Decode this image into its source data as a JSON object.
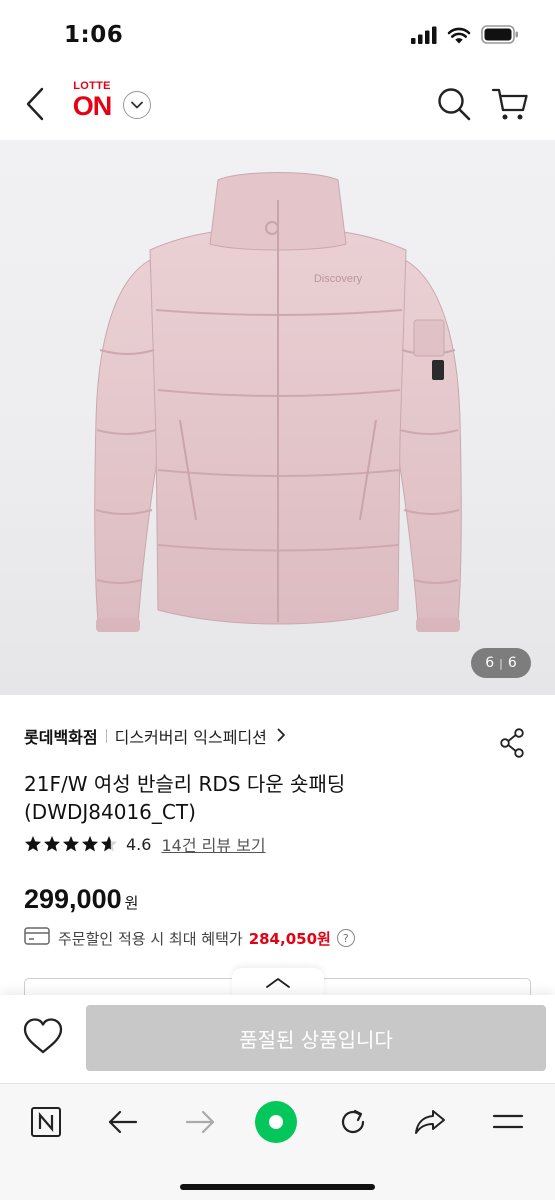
{
  "status_bar": {
    "time": "1:06",
    "icons": [
      "cellular-signal-icon",
      "wifi-icon",
      "battery-icon"
    ]
  },
  "header": {
    "back_icon": "chevron-left-icon",
    "logo_top": "LOTTE",
    "logo_main": "ON",
    "logo_dropdown_icon": "chevron-down-icon",
    "search_icon": "search-icon",
    "cart_icon": "cart-icon"
  },
  "gallery": {
    "current": "6",
    "separator": "|",
    "total": "6",
    "product_print": "Discovery"
  },
  "product": {
    "brand": "롯데백화점",
    "brand_line": "디스커버리 익스페디션",
    "title_line1": "21F/W 여성 반슬리 RDS 다운 숏패딩",
    "title_line2": "(DWDJ84016_CT)",
    "rating": "4.6",
    "review_link": "14건 리뷰 보기",
    "stars_value": 4.6,
    "stars_max": 5,
    "price": "299,000",
    "price_unit": "원",
    "benefit_text": "주문할인 적용 시 최대 혜택가",
    "benefit_price": "284,050원",
    "help_glyph": "?"
  },
  "purchase_bar": {
    "wish_icon": "heart-icon",
    "soldout_label": "품절된 상품입니다"
  },
  "browser_toolbar": {
    "items": [
      "naver-home-icon",
      "back-arrow-icon",
      "forward-arrow-icon",
      "green-dot-icon",
      "refresh-icon",
      "share-icon",
      "menu-icon"
    ]
  },
  "colors": {
    "brand_red": "#e60012",
    "soldout_gray": "#c8c8c8",
    "naver_green": "#03c75a",
    "jacket_pink": "#e6c9cd"
  }
}
